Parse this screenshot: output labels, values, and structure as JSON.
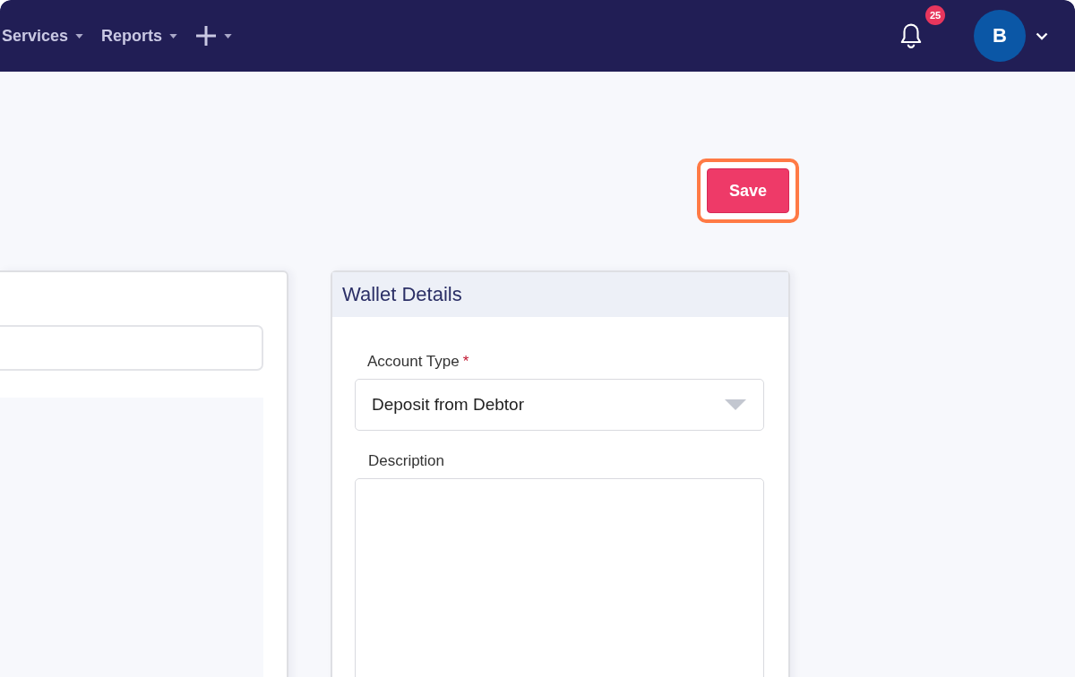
{
  "navbar": {
    "menu": [
      {
        "kind": "text",
        "label": "Services"
      },
      {
        "kind": "text",
        "label": "Reports"
      },
      {
        "kind": "add"
      }
    ],
    "notifications": {
      "count": "25"
    },
    "user": {
      "initial": "B"
    }
  },
  "toolbar": {
    "save_button": {
      "label": "Save",
      "highlighted": true
    }
  },
  "wallet_details": {
    "title": "Wallet Details",
    "fields": [
      {
        "kind": "select",
        "label": "Account Type",
        "required_mark": "*",
        "value": "Deposit from Debtor"
      },
      {
        "kind": "textarea",
        "label": "Description"
      }
    ]
  }
}
